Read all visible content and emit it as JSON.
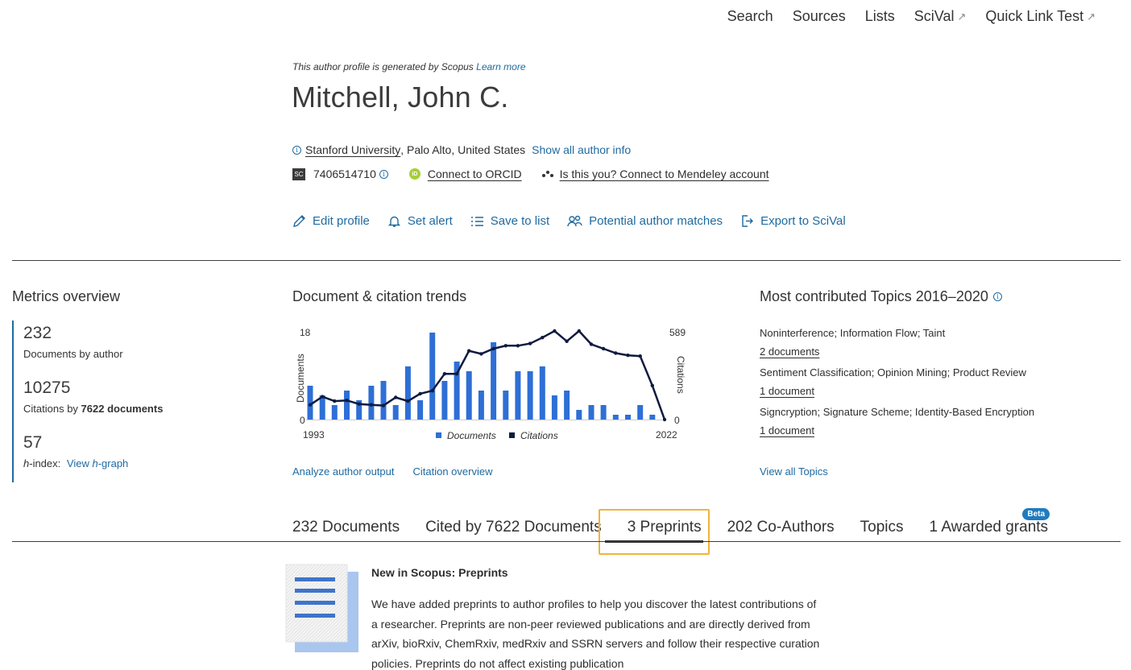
{
  "topnav": [
    {
      "label": "Search",
      "external": false
    },
    {
      "label": "Sources",
      "external": false
    },
    {
      "label": "Lists",
      "external": false
    },
    {
      "label": "SciVal",
      "external": true
    },
    {
      "label": "Quick Link Test",
      "external": true
    }
  ],
  "header": {
    "generated_text": "This author profile is generated by Scopus",
    "learn_more": "Learn more",
    "name": "Mitchell, John C.",
    "affiliation_institution": "Stanford University",
    "affiliation_location": ", Palo Alto, United States",
    "show_all_info": "Show all author info",
    "scopus_badge": "SC",
    "author_id": "7406514710",
    "orcid_badge": "iD",
    "orcid_link": "Connect to ORCID",
    "mendeley_link": "Is this you? Connect to Mendeley account"
  },
  "actions": [
    {
      "label": "Edit profile",
      "icon": "pencil-icon"
    },
    {
      "label": "Set alert",
      "icon": "bell-icon"
    },
    {
      "label": "Save to list",
      "icon": "list-icon"
    },
    {
      "label": "Potential author matches",
      "icon": "people-icon"
    },
    {
      "label": "Export to SciVal",
      "icon": "export-icon"
    }
  ],
  "metrics": {
    "title": "Metrics overview",
    "documents_value": "232",
    "documents_label": "Documents by author",
    "citations_value": "10275",
    "citations_label_prefix": "Citations by",
    "citations_label_bold": "7622 documents",
    "hindex_value": "57",
    "hindex_label_h": "h",
    "hindex_label_rest": "-index:",
    "hindex_link_prefix": "View",
    "hindex_link_h": "h",
    "hindex_link_suffix": "-graph"
  },
  "trends": {
    "title": "Document & citation trends",
    "analyze_link": "Analyze author output",
    "citation_overview_link": "Citation overview"
  },
  "chart_data": {
    "type": "bar",
    "x_start_label": "1993",
    "x_end_label": "2022",
    "years": [
      1993,
      1994,
      1995,
      1996,
      1997,
      1998,
      1999,
      2000,
      2001,
      2002,
      2003,
      2004,
      2005,
      2006,
      2007,
      2008,
      2009,
      2010,
      2011,
      2012,
      2013,
      2014,
      2015,
      2016,
      2017,
      2018,
      2019,
      2020,
      2021,
      2022
    ],
    "ylabel_left": "Documents",
    "ylabel_right": "Citations",
    "ylim_left": [
      0,
      18
    ],
    "ylim_right": [
      0,
      589
    ],
    "ytick_left_max": "18",
    "ytick_left_min": "0",
    "ytick_right_max": "589",
    "ytick_right_min": "0",
    "series": [
      {
        "name": "Documents",
        "type": "bar",
        "color": "#2e6fd6",
        "values": [
          7,
          5,
          3,
          6,
          4,
          7,
          8,
          3,
          11,
          4,
          18,
          8,
          12,
          10,
          6,
          16,
          6,
          10,
          10,
          11,
          5,
          6,
          2,
          3,
          3,
          1,
          1,
          3,
          1,
          0
        ]
      },
      {
        "name": "Citations",
        "type": "line",
        "color": "#0f1a40",
        "values": [
          100,
          155,
          125,
          130,
          105,
          100,
          95,
          150,
          125,
          175,
          195,
          310,
          310,
          465,
          445,
          480,
          500,
          500,
          515,
          555,
          600,
          530,
          600,
          510,
          480,
          450,
          435,
          430,
          230,
          0
        ]
      }
    ],
    "legend": "bottom"
  },
  "topics": {
    "title": "Most contributed Topics 2016–2020",
    "items": [
      {
        "name": "Noninterference; Information Flow; Taint",
        "docs": "2 documents"
      },
      {
        "name": "Sentiment Classification; Opinion Mining; Product Review",
        "docs": "1 document"
      },
      {
        "name": "Signcryption; Signature Scheme; Identity-Based Encryption",
        "docs": "1 document"
      }
    ],
    "view_all": "View all Topics"
  },
  "tabs": [
    {
      "label": "232 Documents"
    },
    {
      "label": "Cited by 7622 Documents"
    },
    {
      "label": "3 Preprints"
    },
    {
      "label": "202 Co-Authors"
    },
    {
      "label": "Topics"
    },
    {
      "label": "1 Awarded grants"
    }
  ],
  "beta_badge": "Beta",
  "preprints_notice": {
    "title": "New in Scopus: Preprints",
    "body": "We have added preprints to author profiles to help you discover the latest contributions of a researcher. Preprints are non-peer reviewed publications and are directly derived from arXiv, bioRxiv, ChemRxiv, medRxiv and SSRN servers and follow their respective curation policies. Preprints do not affect existing publication"
  },
  "colors": {
    "link": "#1f6aa0",
    "bar": "#2e6fd6",
    "line": "#0f1a40",
    "highlight": "#f0b43c",
    "beta": "#1f7bbf"
  }
}
